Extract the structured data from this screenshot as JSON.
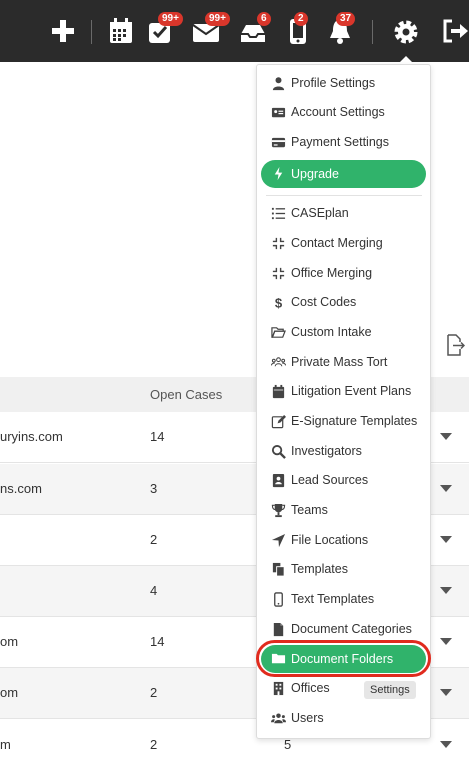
{
  "topbar": {
    "badges": {
      "tasks": "99+",
      "mail": "99+",
      "inbox": "6",
      "mobile": "2",
      "notifications": "37"
    }
  },
  "table": {
    "header": {
      "open_cases": "Open Cases"
    },
    "rows": [
      {
        "name": "uryins.com",
        "open": "14",
        "third": ""
      },
      {
        "name": "ns.com",
        "open": "3",
        "third": ""
      },
      {
        "name": "",
        "open": "2",
        "third": ""
      },
      {
        "name": "",
        "open": "4",
        "third": ""
      },
      {
        "name": "om",
        "open": "14",
        "third": ""
      },
      {
        "name": "om",
        "open": "2",
        "third": ""
      },
      {
        "name": "m",
        "open": "2",
        "third": "5"
      }
    ]
  },
  "menu": {
    "items": [
      {
        "label": "Profile Settings",
        "icon": "user-icon"
      },
      {
        "label": "Account Settings",
        "icon": "id-card-icon"
      },
      {
        "label": "Payment Settings",
        "icon": "credit-card-icon"
      },
      {
        "label": "Upgrade",
        "icon": "bolt-icon"
      },
      {
        "label": "CASEplan",
        "icon": "list-icon"
      },
      {
        "label": "Contact Merging",
        "icon": "merge-icon"
      },
      {
        "label": "Office Merging",
        "icon": "merge-icon"
      },
      {
        "label": "Cost Codes",
        "icon": "dollar-icon"
      },
      {
        "label": "Custom Intake",
        "icon": "folder-open-icon"
      },
      {
        "label": "Private Mass Tort",
        "icon": "users-outline-icon"
      },
      {
        "label": "Litigation Event Plans",
        "icon": "calendar-icon"
      },
      {
        "label": "E-Signature Templates",
        "icon": "edit-icon"
      },
      {
        "label": "Investigators",
        "icon": "search-icon"
      },
      {
        "label": "Lead Sources",
        "icon": "address-card-icon"
      },
      {
        "label": "Teams",
        "icon": "trophy-icon"
      },
      {
        "label": "File Locations",
        "icon": "location-arrow-icon"
      },
      {
        "label": "Templates",
        "icon": "copy-icon"
      },
      {
        "label": "Text Templates",
        "icon": "mobile-icon"
      },
      {
        "label": "Document Categories",
        "icon": "file-icon"
      },
      {
        "label": "Document Folders",
        "icon": "folder-icon"
      },
      {
        "label": "Offices",
        "icon": "building-icon"
      },
      {
        "label": "Users",
        "icon": "users-icon"
      }
    ],
    "tooltip": "Settings"
  },
  "colors": {
    "topbar": "#2b2b2b",
    "accent_green": "#30b36b",
    "badge_red": "#d9362b",
    "highlight_ring": "#e02b1e"
  }
}
